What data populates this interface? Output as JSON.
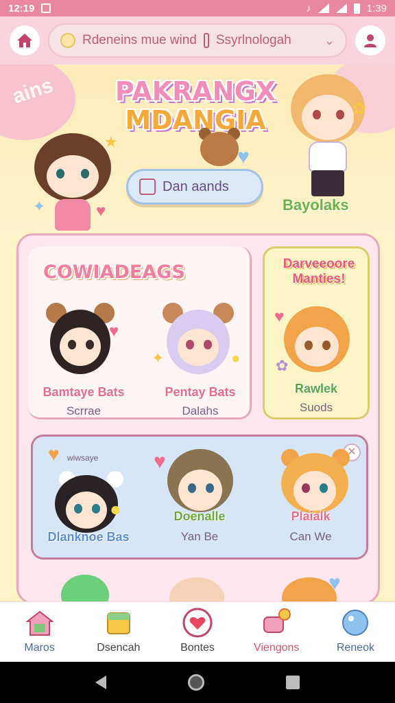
{
  "status_bar": {
    "time": "12:19",
    "right_time": "1:39"
  },
  "app_bar": {
    "search_text_1": "Rdeneins mue wind",
    "search_text_2": "Ssyrlnologah",
    "home_icon": "home-icon",
    "profile_icon": "profile-icon"
  },
  "hero": {
    "blob_text": "ains",
    "title_line1": "PAKRANGX",
    "title_line2": "MDANGIA",
    "button_label": "Dan aands",
    "tag": "Bayolaks"
  },
  "panel": {
    "section_title": "COWIADEAGS",
    "yellow_title": "Darveeoore Manties!",
    "cards": [
      {
        "name": "Bamtaye Bats",
        "sub": "Scrrae",
        "name_color": "#e86a8d"
      },
      {
        "name": "Pentay Bats",
        "sub": "Dalahs",
        "name_color": "#e86a8d"
      },
      {
        "name": "Rawlek",
        "sub": "Suods",
        "name_color": "#5aa840"
      },
      {
        "name": "Dlanknoe Bas",
        "sub": "",
        "name_color": "#5b8ed6"
      },
      {
        "name": "Doenalle",
        "sub": "Yan Be",
        "name_color": "#6aa83c"
      },
      {
        "name": "Plaialk",
        "sub": "Can We",
        "name_color": "#e86a8d"
      }
    ],
    "close_glyph": "✕",
    "blue_header_tag": "wiwsaye"
  },
  "bottom_nav": {
    "items": [
      {
        "label": "Maros",
        "icon": "house-icon",
        "color": "#4f6aa3"
      },
      {
        "label": "Dsencah",
        "icon": "box-icon",
        "color": "#333333"
      },
      {
        "label": "Bontes",
        "icon": "heart-icon",
        "color": "#333333"
      },
      {
        "label": "Viengons",
        "icon": "chat-icon",
        "color": "#d25570"
      },
      {
        "label": "Reneok",
        "icon": "bubble-icon",
        "color": "#4f6aa3"
      }
    ]
  },
  "system_nav": {
    "back": "back-icon",
    "home": "home-button-icon",
    "recents": "recents-icon"
  }
}
